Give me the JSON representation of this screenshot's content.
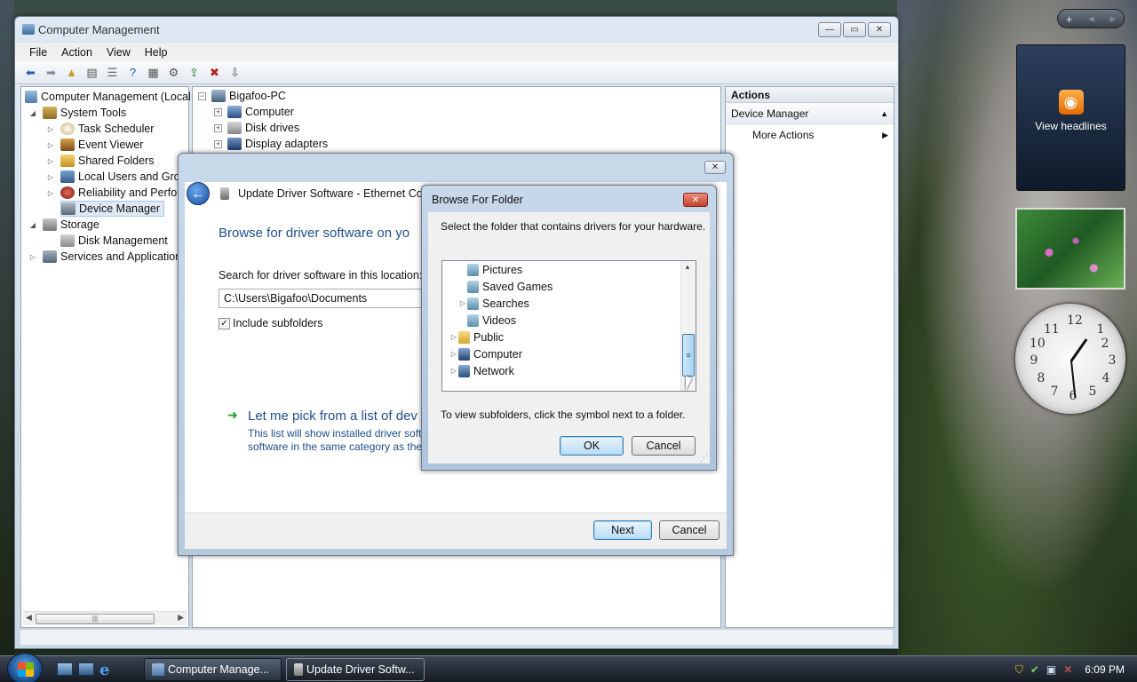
{
  "desktop": {
    "feed_gadget_label": "View headlines"
  },
  "computer_management": {
    "title": "Computer Management",
    "menu": [
      "File",
      "Action",
      "View",
      "Help"
    ],
    "left_tree": [
      {
        "label": "Computer Management (Local"
      },
      {
        "label": "System Tools"
      },
      {
        "label": "Task Scheduler"
      },
      {
        "label": "Event Viewer"
      },
      {
        "label": "Shared Folders"
      },
      {
        "label": "Local Users and Group"
      },
      {
        "label": "Reliability and Perform"
      },
      {
        "label": "Device Manager"
      },
      {
        "label": "Storage"
      },
      {
        "label": "Disk Management"
      },
      {
        "label": "Services and Applications"
      }
    ],
    "device_tree": [
      {
        "label": "Bigafoo-PC"
      },
      {
        "label": "Computer"
      },
      {
        "label": "Disk drives"
      },
      {
        "label": "Display adapters"
      }
    ],
    "actions": {
      "header": "Actions",
      "section": "Device Manager",
      "more": "More Actions"
    }
  },
  "update_driver": {
    "title": "Update Driver Software - Ethernet Cont",
    "heading": "Browse for driver software on yo",
    "search_label": "Search for driver software in this location:",
    "path_value": "C:\\Users\\Bigafoo\\Documents",
    "include_subfolders": "Include subfolders",
    "pick_link": "Let me pick from a list of dev",
    "pick_desc_1": "This list will show installed driver soft",
    "pick_desc_2": "software in the same category as the",
    "next": "Next",
    "cancel": "Cancel"
  },
  "browse_folder": {
    "title": "Browse For Folder",
    "instruction": "Select the folder that contains drivers for your hardware.",
    "items": [
      {
        "label": "Pictures"
      },
      {
        "label": "Saved Games"
      },
      {
        "label": "Searches"
      },
      {
        "label": "Videos"
      },
      {
        "label": "Public"
      },
      {
        "label": "Computer"
      },
      {
        "label": "Network"
      }
    ],
    "hint": "To view subfolders, click the symbol next to a folder.",
    "ok": "OK",
    "cancel": "Cancel"
  },
  "taskbar": {
    "tasks": [
      {
        "label": "Computer Manage..."
      },
      {
        "label": "Update Driver Softw..."
      }
    ],
    "clock": "6:09 PM"
  }
}
